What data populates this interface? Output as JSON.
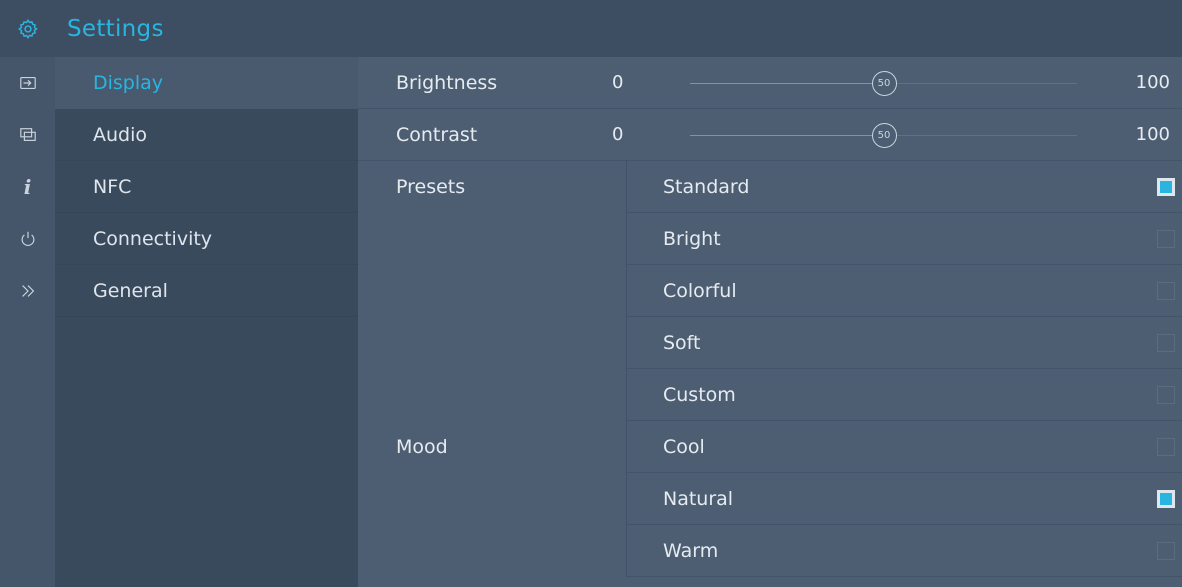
{
  "header": {
    "title": "Settings",
    "icon": "gear-icon"
  },
  "iconbar": [
    {
      "name": "input-icon",
      "glyph": "⇨"
    },
    {
      "name": "screens-icon",
      "glyph": "⧉"
    },
    {
      "name": "info-icon",
      "glyph": "i"
    },
    {
      "name": "power-icon",
      "glyph": "⏻"
    },
    {
      "name": "double-chevron-right-icon",
      "glyph": "»"
    }
  ],
  "nav": {
    "items": [
      {
        "label": "Display",
        "active": true
      },
      {
        "label": "Audio",
        "active": false
      },
      {
        "label": "NFC",
        "active": false
      },
      {
        "label": "Connectivity",
        "active": false
      },
      {
        "label": "General",
        "active": false
      }
    ]
  },
  "sliders": [
    {
      "label": "Brightness",
      "min": "0",
      "max": "100",
      "value": 50,
      "value_label": "50"
    },
    {
      "label": "Contrast",
      "min": "0",
      "max": "100",
      "value": 50,
      "value_label": "50"
    }
  ],
  "presets": {
    "label": "Presets",
    "options": [
      {
        "label": "Standard",
        "checked": true
      },
      {
        "label": "Bright",
        "checked": false
      },
      {
        "label": "Colorful",
        "checked": false
      },
      {
        "label": "Soft",
        "checked": false
      },
      {
        "label": "Custom",
        "checked": false
      }
    ]
  },
  "mood": {
    "label": "Mood",
    "options": [
      {
        "label": "Cool",
        "checked": false
      },
      {
        "label": "Natural",
        "checked": true
      },
      {
        "label": "Warm",
        "checked": false
      }
    ]
  },
  "colors": {
    "accent": "#2ab4e0",
    "header_bg": "#3d4e63",
    "nav_bg": "#3a4a5d",
    "main_bg": "#4d5e72"
  }
}
